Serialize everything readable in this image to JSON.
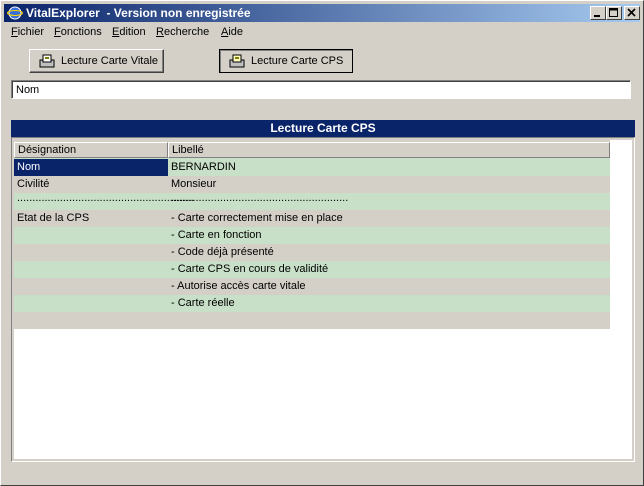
{
  "window": {
    "title": "VitalExplorer  - Version non enregistrée",
    "minimize_label": "minimize",
    "maximize_label": "maximize",
    "close_label": "close"
  },
  "menubar": {
    "items": [
      {
        "underline": "F",
        "rest": "ichier"
      },
      {
        "underline": "F",
        "rest": "onctions"
      },
      {
        "underline": "E",
        "rest": "dition"
      },
      {
        "underline": "R",
        "rest": "echerche"
      },
      {
        "underline": "A",
        "rest": "ide"
      }
    ]
  },
  "toolbar": {
    "vitale_label": "Lecture Carte Vitale",
    "cps_label": "Lecture Carte CPS",
    "vitale_icon": "card-reader-icon",
    "cps_icon": "card-reader-icon"
  },
  "search": {
    "value": "Nom"
  },
  "panel": {
    "title": "Lecture Carte CPS"
  },
  "table": {
    "columns": [
      "Désignation",
      "Libellé"
    ],
    "rows": [
      [
        "Nom",
        "BERNARDIN"
      ],
      [
        "Civilité",
        "Monsieur"
      ],
      [
        "..........................................................",
        ".........................................................."
      ],
      [
        "Etat de la CPS",
        "- Carte correctement mise en place"
      ],
      [
        "",
        "- Carte en fonction"
      ],
      [
        "",
        "- Code déjà présenté"
      ],
      [
        "",
        "- Carte CPS en cours de validité"
      ],
      [
        "",
        "- Autorise accès carte vitale"
      ],
      [
        "",
        "- Carte réelle"
      ],
      [
        "",
        ""
      ]
    ],
    "selected_row": 0
  },
  "colors": {
    "title_bar_start": "#0a246a",
    "title_bar_end": "#a6caf0",
    "row_alt": "#c8e0c8",
    "selection": "#0a246a"
  }
}
